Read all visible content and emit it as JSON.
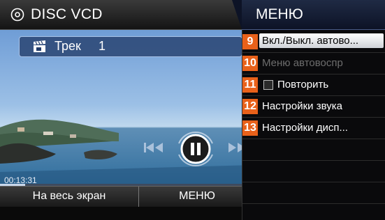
{
  "header": {
    "source_title": "DISC VCD",
    "source_icon": "disc-icon",
    "menu_title": "МЕНЮ"
  },
  "player": {
    "track_label": "Трек",
    "track_number": "1",
    "elapsed_time": "00:13:31",
    "progress_fraction": 0.1,
    "state": "paused"
  },
  "bottom_bar": {
    "fullscreen_label": "На весь экран",
    "menu_label": "МЕНЮ"
  },
  "menu": {
    "items": [
      {
        "badge": "9",
        "label": "Вкл./Выкл. автово...",
        "state": "selected"
      },
      {
        "badge": "10",
        "label": "Меню автовоспр",
        "state": "disabled"
      },
      {
        "badge": "11",
        "label": "Повторить",
        "state": "checkbox-unchecked"
      },
      {
        "badge": "12",
        "label": "Настройки звука",
        "state": "normal"
      },
      {
        "badge": "13",
        "label": "Настройки дисп...",
        "state": "normal"
      }
    ]
  },
  "colors": {
    "badge": "#e8611a",
    "menu_header": "#1f2a44",
    "track_bar": "#223c69"
  }
}
